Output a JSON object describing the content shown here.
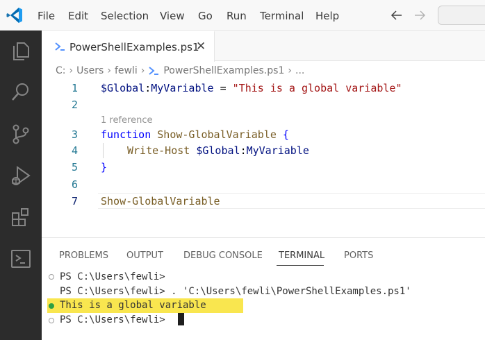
{
  "menu": [
    "File",
    "Edit",
    "Selection",
    "View",
    "Go",
    "Run",
    "Terminal",
    "Help"
  ],
  "tab": {
    "label": "PowerShellExamples.ps1",
    "close": "✕"
  },
  "breadcrumb": {
    "drive": "C:",
    "users": "Users",
    "user": "fewli",
    "file": "PowerShellExamples.ps1",
    "more": "...",
    "separator": "›"
  },
  "editor": {
    "line_numbers": [
      "1",
      "2",
      "3",
      "4",
      "5",
      "6",
      "7"
    ],
    "codelens": "1 reference",
    "line1": {
      "var_scope": "$Global",
      "colon": ":",
      "var_name": "MyVariable",
      "op": " = ",
      "string": "\"This is a global variable\""
    },
    "line3": {
      "keyword": "function",
      "name": " Show-GlobalVariable ",
      "brace": "{"
    },
    "line4": {
      "cmd": "Write-Host ",
      "var_scope": "$Global",
      "colon": ":",
      "var_name": "MyVariable"
    },
    "line5": {
      "brace": "}"
    },
    "line7": {
      "call": "Show-GlobalVariable"
    }
  },
  "panel": {
    "tabs": [
      "PROBLEMS",
      "OUTPUT",
      "DEBUG CONSOLE",
      "TERMINAL",
      "PORTS"
    ],
    "active_tab": "TERMINAL"
  },
  "terminal": {
    "lines": [
      "PS C:\\Users\\fewli>",
      "PS C:\\Users\\fewli> . 'C:\\Users\\fewli\\PowerShellExamples.ps1'",
      "This is a global variable",
      "PS C:\\Users\\fewli>"
    ]
  },
  "colors": {
    "activity_bar": "#2c2c2c",
    "accent_blue": "#0078d4",
    "highlight": "#f9e64f",
    "success": "#2ea043",
    "powershell_icon": "#5391fe"
  }
}
